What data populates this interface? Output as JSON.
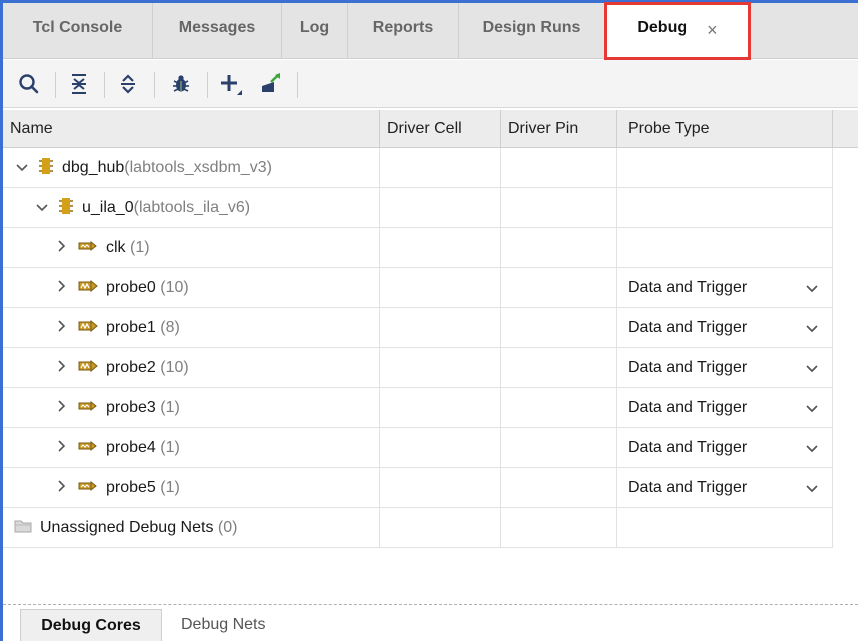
{
  "tabs": [
    {
      "label": "Tcl Console",
      "active": false
    },
    {
      "label": "Messages",
      "active": false
    },
    {
      "label": "Log",
      "active": false
    },
    {
      "label": "Reports",
      "active": false
    },
    {
      "label": "Design Runs",
      "active": false
    },
    {
      "label": "Debug",
      "active": true,
      "close": "×"
    }
  ],
  "toolbar": {
    "icons": [
      "search-icon",
      "collapse-all-icon",
      "expand-all-icon",
      "bug-icon",
      "add-icon",
      "set-up-debug-icon"
    ]
  },
  "table": {
    "columns": [
      "Name",
      "Driver Cell",
      "Driver Pin",
      "Probe Type"
    ],
    "rows": [
      {
        "level": 0,
        "expander": "v",
        "icon": "debug-core-icon",
        "name": "dbg_hub",
        "detail": "(labtools_xsdbm_v3)",
        "driver_cell": "",
        "driver_pin": "",
        "probe_type": ""
      },
      {
        "level": 1,
        "expander": "v",
        "icon": "debug-core-icon",
        "name": "u_ila_0",
        "detail": "(labtools_ila_v6)",
        "driver_cell": "",
        "driver_pin": "",
        "probe_type": ""
      },
      {
        "level": 2,
        "expander": ">",
        "icon": "net-icon",
        "name": "clk",
        "detail": " (1)",
        "driver_cell": "",
        "driver_pin": "",
        "probe_type": ""
      },
      {
        "level": 2,
        "expander": ">",
        "icon": "bus-net-icon",
        "name": "probe0",
        "detail": " (10)",
        "driver_cell": "",
        "driver_pin": "",
        "probe_type": "Data and Trigger"
      },
      {
        "level": 2,
        "expander": ">",
        "icon": "bus-net-icon",
        "name": "probe1",
        "detail": " (8)",
        "driver_cell": "",
        "driver_pin": "",
        "probe_type": "Data and Trigger"
      },
      {
        "level": 2,
        "expander": ">",
        "icon": "bus-net-icon",
        "name": "probe2",
        "detail": " (10)",
        "driver_cell": "",
        "driver_pin": "",
        "probe_type": "Data and Trigger"
      },
      {
        "level": 2,
        "expander": ">",
        "icon": "net-icon",
        "name": "probe3",
        "detail": " (1)",
        "driver_cell": "",
        "driver_pin": "",
        "probe_type": "Data and Trigger"
      },
      {
        "level": 2,
        "expander": ">",
        "icon": "net-icon",
        "name": "probe4",
        "detail": " (1)",
        "driver_cell": "",
        "driver_pin": "",
        "probe_type": "Data and Trigger"
      },
      {
        "level": 2,
        "expander": ">",
        "icon": "net-icon",
        "name": "probe5",
        "detail": " (1)",
        "driver_cell": "",
        "driver_pin": "",
        "probe_type": "Data and Trigger"
      },
      {
        "level": 0,
        "expander": "",
        "icon": "folder-icon",
        "name": "Unassigned Debug Nets",
        "detail": " (0)",
        "driver_cell": "",
        "driver_pin": "",
        "probe_type": ""
      }
    ]
  },
  "bottom_tabs": [
    {
      "label": "Debug Cores",
      "active": true
    },
    {
      "label": "Debug Nets",
      "active": false
    }
  ],
  "colors": {
    "accent": "#3b6fd1",
    "highlight": "#e53935",
    "core_icon": "#d4a017",
    "sub_text": "#7f7f7f"
  }
}
